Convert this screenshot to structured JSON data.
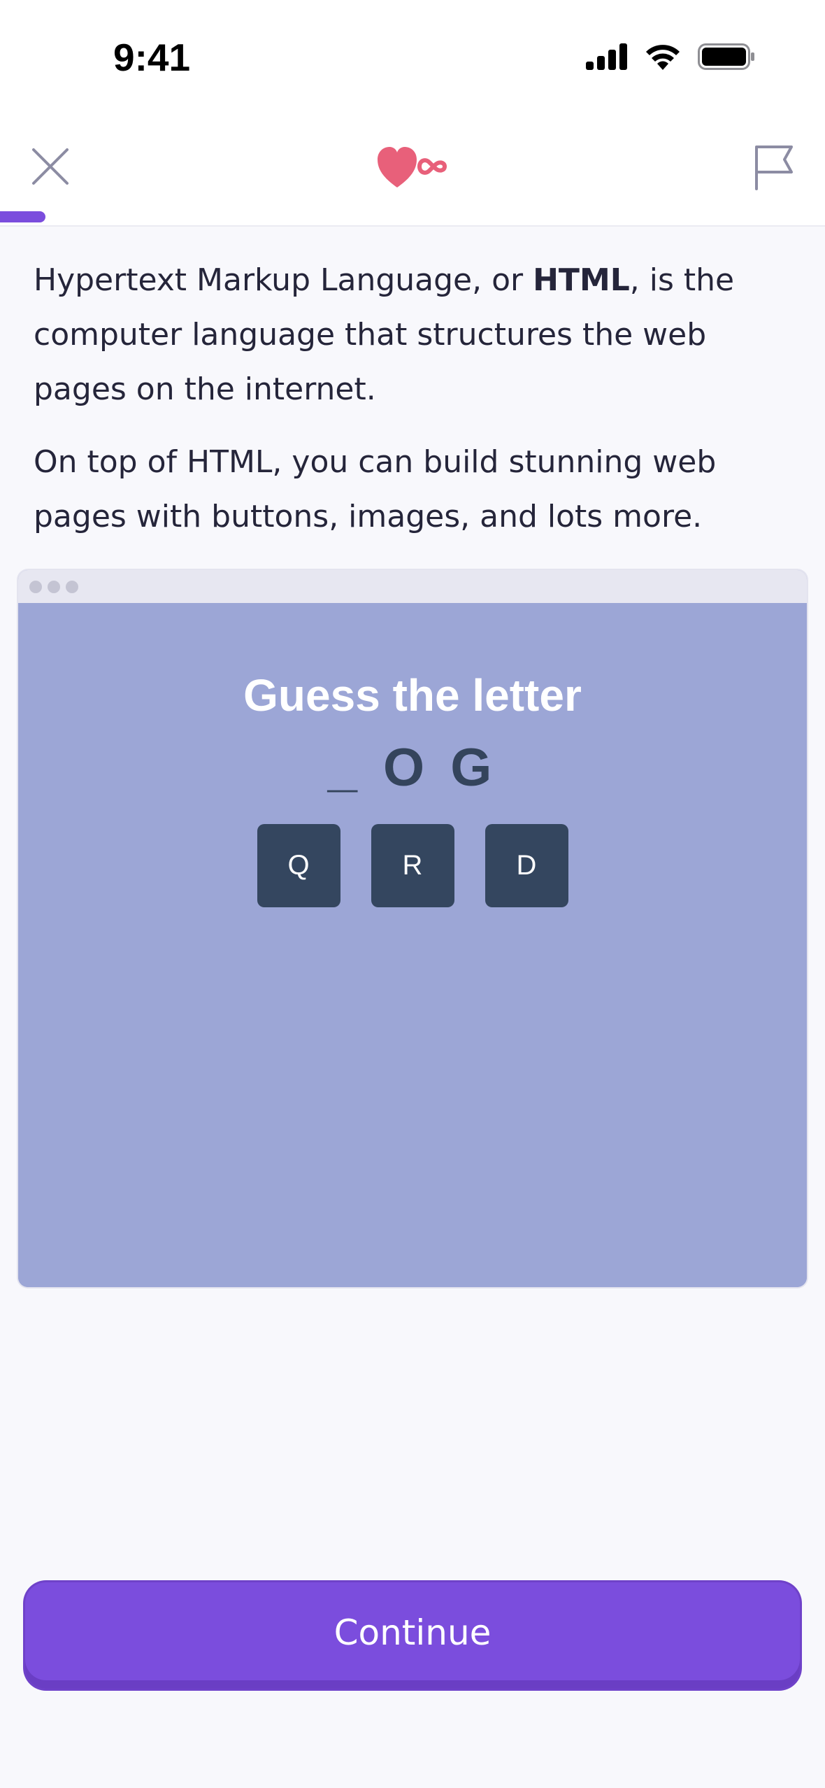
{
  "status_bar": {
    "time": "9:41",
    "icons": [
      "cellular-signal-icon",
      "wifi-icon",
      "battery-icon"
    ]
  },
  "nav": {
    "close_icon": "close-icon",
    "lives_icon": "heart-infinity-icon",
    "lives_value": "∞",
    "report_icon": "flag-icon",
    "progress": 0.055
  },
  "lesson": {
    "p1_before": "Hypertext Markup Language, or ",
    "p1_bold": "HTML",
    "p1_after": ", is the computer language that structures the web pages on the internet.",
    "p2": "On top of HTML, you can build stunning web pages with buttons, images, and lots more."
  },
  "preview": {
    "title": "Guess the letter",
    "word": "_ O G",
    "letters": [
      "Q",
      "R",
      "D"
    ]
  },
  "footer": {
    "continue_label": "Continue"
  },
  "colors": {
    "accent": "#7b4ddd",
    "heart": "#e8607a",
    "preview_bg": "#9ca6d6",
    "letter_button": "#34465f"
  }
}
